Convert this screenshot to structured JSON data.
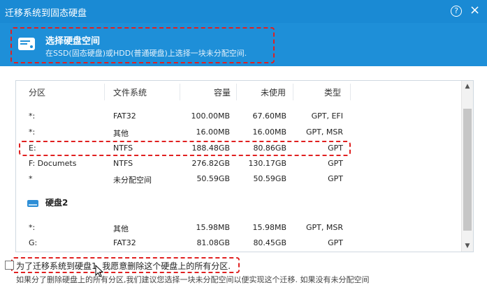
{
  "window": {
    "title": "迁移系统到固态硬盘",
    "help_glyph": "?",
    "close_glyph": "×"
  },
  "header": {
    "step_title": "选择硬盘空间",
    "step_subtitle": "在SSD(固态硬盘)或HDD(普通硬盘)上选择一块未分配空间."
  },
  "table": {
    "columns": [
      "分区",
      "文件系统",
      "容量",
      "未使用",
      "类型"
    ],
    "disk1_rows": [
      {
        "partition": "*:",
        "fs": "FAT32",
        "capacity": "100.00MB",
        "unused": "67.60MB",
        "type": "GPT, EFI"
      },
      {
        "partition": "*:",
        "fs": "其他",
        "capacity": "16.00MB",
        "unused": "16.00MB",
        "type": "GPT, MSR"
      },
      {
        "partition": "E:",
        "fs": "NTFS",
        "capacity": "188.48GB",
        "unused": "80.86GB",
        "type": "GPT"
      },
      {
        "partition": "F: Documets",
        "fs": "NTFS",
        "capacity": "276.82GB",
        "unused": "130.17GB",
        "type": "GPT"
      },
      {
        "partition": "*",
        "fs": "未分配空间",
        "capacity": "50.59GB",
        "unused": "50.59GB",
        "type": "GPT"
      }
    ],
    "disk2_label": "硬盘2",
    "disk2_rows": [
      {
        "partition": "*:",
        "fs": "其他",
        "capacity": "15.98MB",
        "unused": "15.98MB",
        "type": "GPT, MSR"
      },
      {
        "partition": "G:",
        "fs": "FAT32",
        "capacity": "81.08GB",
        "unused": "80.45GB",
        "type": "GPT"
      }
    ]
  },
  "consent": {
    "label": "为了迁移系统到硬盘1, 我愿意删除这个硬盘上的所有分区.",
    "checked": false
  },
  "footnote": "如果分了删除硬盘上的所有分区,我们建议您选择一块未分配空间以便实现这个迁移. 如果没有未分配空间"
}
